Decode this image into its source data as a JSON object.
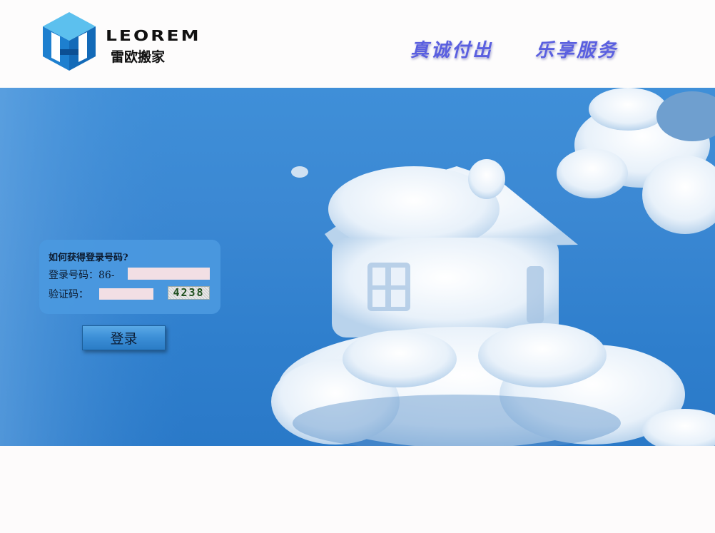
{
  "header": {
    "logo_en": "LEOREM",
    "logo_cn": "雷欧搬家",
    "slogan_1": "真诚付出",
    "slogan_2": "乐享服务"
  },
  "login": {
    "hint": "如何获得登录号码?",
    "phone_label": "登录号码：86-",
    "phone_value": "",
    "code_label": "验证码：",
    "code_value": "",
    "captcha": "4238",
    "submit_label": "登录"
  },
  "colors": {
    "slogan": "#5a5fe0",
    "sky": "#3b88d3",
    "input_bg": "#f2dfe4",
    "panel": "#4a98df"
  }
}
